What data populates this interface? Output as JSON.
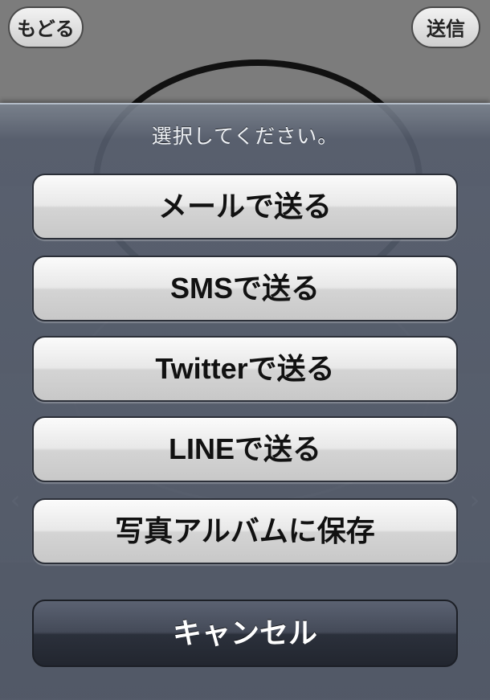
{
  "header": {
    "back_label": "もどる",
    "send_label": "送信"
  },
  "action_sheet": {
    "title": "選択してください。",
    "options": [
      {
        "label": "メールで送る"
      },
      {
        "label": "SMSで送る"
      },
      {
        "label": "Twitterで送る"
      },
      {
        "label": "LINEで送る"
      },
      {
        "label": "写真アルバムに保存"
      }
    ],
    "cancel_label": "キャンセル"
  },
  "colors": {
    "sheet_bg": "#545c6c",
    "option_bg": "#e8e8e8",
    "cancel_bg": "#2b303b"
  }
}
